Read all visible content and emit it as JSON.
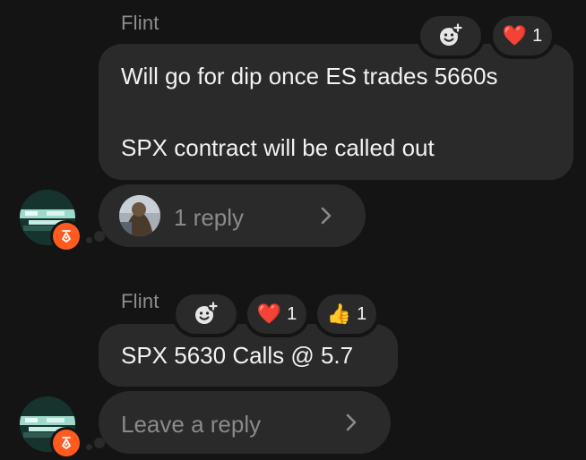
{
  "messages": [
    {
      "author": "Flint",
      "lines": [
        "Will go for dip once ES trades 5660s",
        "SPX contract will be called out"
      ],
      "reactions": [
        {
          "emoji": "❤️",
          "count": "1"
        }
      ],
      "thread": {
        "text": "1 reply"
      }
    },
    {
      "author": "Flint",
      "lines": [
        "SPX 5630 Calls @ 5.7"
      ],
      "reactions": [
        {
          "emoji": "❤️",
          "count": "1"
        },
        {
          "emoji": "👍",
          "count": "1"
        }
      ],
      "thread": {
        "text": "Leave a reply"
      }
    }
  ],
  "colors": {
    "background": "#141414",
    "bubble": "#2a2a2a",
    "badge": "#ff5a1f",
    "muted_text": "#8e8e8e"
  },
  "icons": [
    "add-reaction-icon",
    "chevron-right-icon",
    "pen-badge-icon"
  ]
}
